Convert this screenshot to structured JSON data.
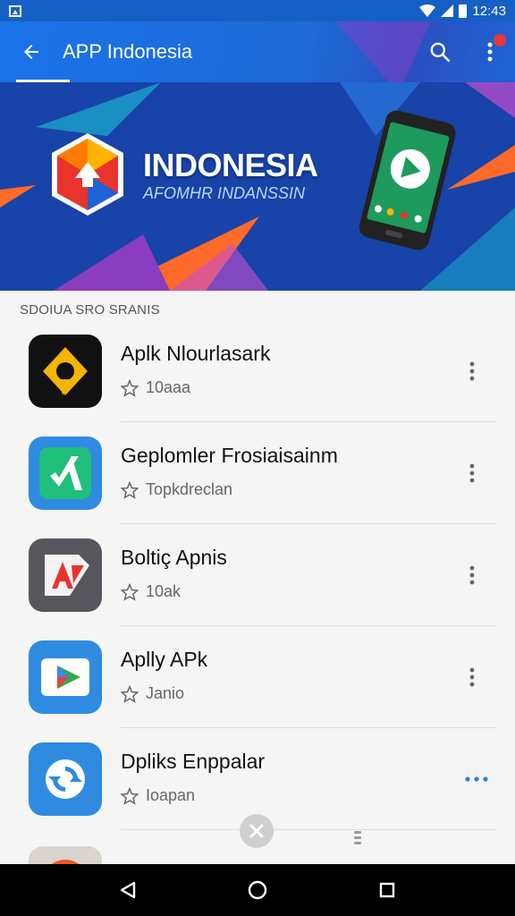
{
  "status_bar": {
    "time": "12:43",
    "icons": [
      "image-icon",
      "wifi-icon",
      "signal-icon",
      "battery-icon"
    ]
  },
  "app_bar": {
    "title": "APP Indonesia",
    "icons": [
      "back-arrow-icon",
      "search-icon",
      "more-vert-icon"
    ]
  },
  "banner": {
    "title": "INDONESIA",
    "subtitle": "AFOMHR INDANSSIN"
  },
  "section": {
    "header": "SDOIUA SRO SRANIS"
  },
  "apps": [
    {
      "name": "Aplk Nlourlasark",
      "meta": "10aaa",
      "icon": "app-icon-yellow-diamond",
      "color": "#111111"
    },
    {
      "name": "Geplomler Frosiaisainm",
      "meta": "Topkdreclan",
      "icon": "app-icon-green-check",
      "color": "#2f8be0"
    },
    {
      "name": "Boltiç Apnis",
      "meta": "10ak",
      "icon": "app-icon-red-arrow",
      "color": "#55575c"
    },
    {
      "name": "Aplly APk",
      "meta": "Janio",
      "icon": "app-icon-play",
      "color": "#2f8be0"
    },
    {
      "name": "Dpliks Enppalar",
      "meta": "Ioapan",
      "icon": "app-icon-sync",
      "color": "#2f8be0"
    },
    {
      "name": "",
      "meta": "",
      "icon": "app-icon-orange",
      "color": "#d9d4cc"
    }
  ],
  "nav": {
    "icons": [
      "back-triangle-icon",
      "home-circle-icon",
      "recents-square-icon"
    ]
  },
  "colors": {
    "primary": "#1a73e8",
    "banner_bg": "#1843a8",
    "accent_orange": "#ff6a2a",
    "accent_purple": "#8a3dbf"
  }
}
